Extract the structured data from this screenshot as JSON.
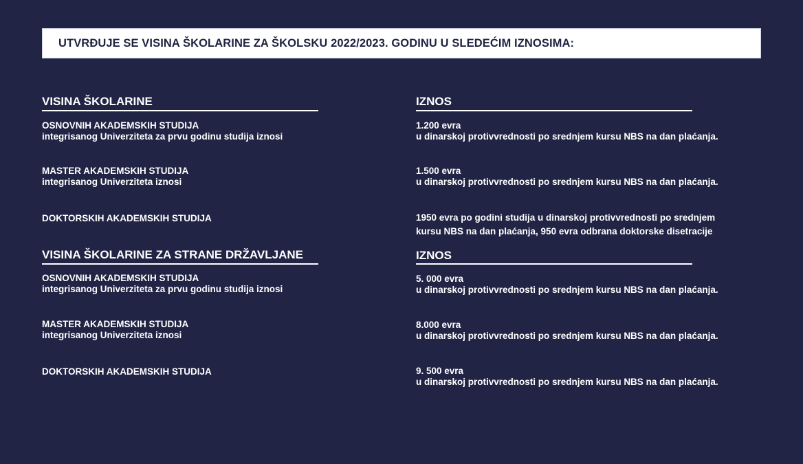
{
  "banner": {
    "text": "UTVRĐUJE SE VISINA ŠKOLARINE ZA ŠKOLSKU 2022/2023. GODINU U SLEDEĆIM IZNOSIMA:"
  },
  "sections": [
    {
      "left_heading": "VISINA ŠKOLARINE",
      "right_heading": "IZNOS",
      "rows": [
        {
          "label_line1": "OSNOVNIH AKADEMSKIH STUDIJA",
          "label_line2": "integrisanog Univerziteta za prvu godinu studija iznosi",
          "amount_line1": "1.200 evra",
          "amount_line2": "u dinarskoj protivvrednosti po srednjem kursu NBS na dan plaćanja."
        },
        {
          "label_line1": "MASTER AKADEMSKIH STUDIJA",
          "label_line2": "integrisanog Univerziteta iznosi",
          "amount_line1": "1.500 evra",
          "amount_line2": "u dinarskoj protivvrednosti po srednjem kursu NBS na dan plaćanja."
        },
        {
          "label_line1": "DOKTORSKIH AKADEMSKIH STUDIJA",
          "label_line2": "",
          "amount_line1": "1950 evra po godini studija u dinarskoj protivvrednosti po srednjem",
          "amount_line2": "kursu NBS na dan plaćanja, 950 evra odbrana doktorske disetracije"
        }
      ]
    },
    {
      "left_heading": "VISINA ŠKOLARINE ZA STRANE DRŽAVLJANE",
      "right_heading": "IZNOS",
      "rows": [
        {
          "label_line1": "OSNOVNIH AKADEMSKIH STUDIJA",
          "label_line2": "integrisanog Univerziteta za prvu godinu studija iznosi",
          "amount_line1": "5. 000 evra",
          "amount_line2": "u dinarskoj protivvrednosti po srednjem kursu NBS na dan plaćanja."
        },
        {
          "label_line1": "MASTER AKADEMSKIH STUDIJA",
          "label_line2": "integrisanog Univerziteta iznosi",
          "amount_line1": "8.000 evra",
          "amount_line2": "u dinarskoj protivvrednosti po srednjem kursu NBS na dan plaćanja."
        },
        {
          "label_line1": "DOKTORSKIH AKADEMSKIH STUDIJA",
          "label_line2": "",
          "amount_line1": "9. 500 evra",
          "amount_line2": "u dinarskoj protivvrednosti po srednjem kursu NBS na dan plaćanja."
        }
      ]
    }
  ]
}
